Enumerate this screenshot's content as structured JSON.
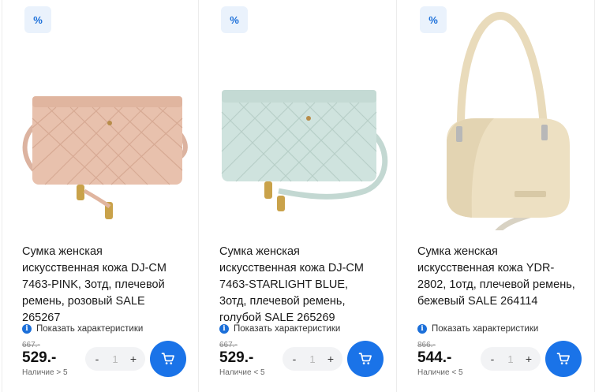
{
  "products": [
    {
      "discount_badge": "%",
      "title": "Сумка женская искусственная кожа DJ-CM 7463-PINK, 3отд, плечевой ремень, розовый SALE 265267",
      "specs_link": "Показать характеристики",
      "old_price": "667.-",
      "price": "529.-",
      "stock": "Наличие > 5",
      "qty_minus": "-",
      "qty_value": "1",
      "qty_plus": "+",
      "bag_color": "#e8c1ad"
    },
    {
      "discount_badge": "%",
      "title": "Сумка женская искусственная кожа DJ-CM 7463-STARLIGHT BLUE, 3отд, плечевой ремень, голубой SALE 265269",
      "specs_link": "Показать характеристики",
      "old_price": "667.-",
      "price": "529.-",
      "stock": "Наличие < 5",
      "qty_minus": "-",
      "qty_value": "1",
      "qty_plus": "+",
      "bag_color": "#cfe3de"
    },
    {
      "discount_badge": "%",
      "title": "Сумка женская искусственная кожа YDR-2802, 1отд, плечевой ремень, бежевый SALE 264114",
      "specs_link": "Показать характеристики",
      "old_price": "866.-",
      "price": "544.-",
      "stock": "Наличие < 5",
      "qty_minus": "-",
      "qty_value": "1",
      "qty_plus": "+",
      "bag_color": "#ede0c2"
    }
  ],
  "colors": {
    "accent": "#1a73e8",
    "badge_bg": "#eaf2fc"
  }
}
